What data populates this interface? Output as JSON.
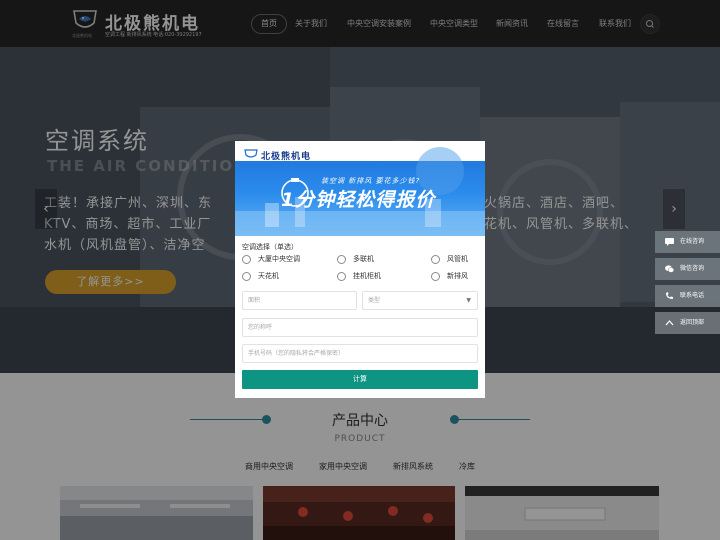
{
  "header": {
    "brand_name": "北极熊机电",
    "brand_tagline": "空调工程 新排风系统   电话:020-39292197",
    "brand_badge_text": "北极熊机电",
    "nav": [
      {
        "label": "首页",
        "active": true
      },
      {
        "label": "关于我们"
      },
      {
        "label": "中央空调安装案例"
      },
      {
        "label": "中央空调类型"
      },
      {
        "label": "新闻资讯"
      },
      {
        "label": "在线留言"
      },
      {
        "label": "联系我们"
      }
    ]
  },
  "banner": {
    "title": "空调系统",
    "subtitle": "THE AIR CONDITIO",
    "lines": [
      "工装！承接广州、深圳、东",
      "KTV、商场、超市、工业厂",
      "水机（风机盘管）、洁净空"
    ],
    "lines_right": [
      "火锅店、酒店、酒吧、",
      "花机、风管机、多联机、"
    ],
    "cta": "了解更多>>",
    "prev": "‹",
    "next": "›"
  },
  "float_bar": [
    {
      "label": "在线咨询",
      "icon": "chat-icon"
    },
    {
      "label": "微信咨询",
      "icon": "wechat-icon"
    },
    {
      "label": "联系电话",
      "icon": "phone-icon"
    },
    {
      "label": "返回顶部",
      "icon": "arrow-up-icon"
    }
  ],
  "products": {
    "title": "产品中心",
    "subtitle": "PRODUCT",
    "tabs": [
      "商用中央空调",
      "家用中央空调",
      "新排风系统",
      "冷库"
    ]
  },
  "modal": {
    "brand": "北极熊机电",
    "slogan": "装空调 新排风 要花多少钱?",
    "headline": "1分钟轻松得报价",
    "close": "X",
    "question": "空调选择（单选）",
    "options": [
      [
        "大厦中央空调",
        "多联机",
        "风管机"
      ],
      [
        "天花机",
        "挂机柜机",
        "新排风"
      ]
    ],
    "area_placeholder": "面积",
    "type_placeholder": "类型",
    "name_placeholder": "您的称呼",
    "phone_placeholder": "手机号码（您的隐私将会严格保密）",
    "submit": "计算"
  },
  "colors": {
    "header_bg": "#262626",
    "accent_teal": "#0e9483",
    "cta_gold": "#d9a22b",
    "product_accent": "#2b8fa0",
    "modal_blue": "#1b6fd6"
  }
}
